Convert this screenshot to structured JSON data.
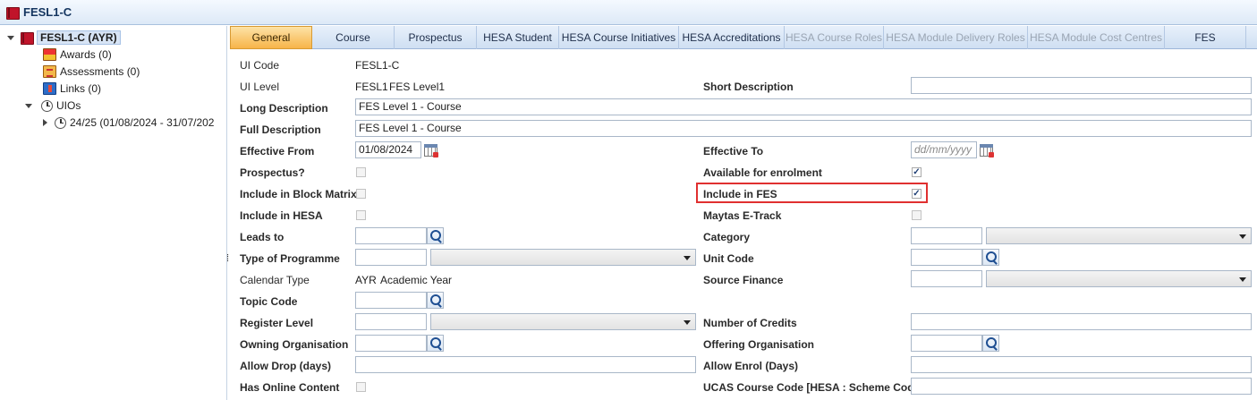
{
  "window": {
    "title": "FESL1-C"
  },
  "tree": {
    "root": "FESL1-C (AYR)",
    "awards": "Awards (0)",
    "assessments": "Assessments (0)",
    "links": "Links (0)",
    "uios": "UIOs",
    "uio_child": "24/25 (01/08/2024 - 31/07/202"
  },
  "tabs": [
    {
      "label": "General"
    },
    {
      "label": "Course"
    },
    {
      "label": "Prospectus"
    },
    {
      "label": "HESA Student"
    },
    {
      "label": "HESA Course Initiatives"
    },
    {
      "label": "HESA Accreditations"
    },
    {
      "label": "HESA Course Roles"
    },
    {
      "label": "HESA Module Delivery Roles"
    },
    {
      "label": "HESA Module Cost Centres"
    },
    {
      "label": "FES"
    }
  ],
  "form": {
    "ui_code": {
      "label": "UI Code",
      "value": "FESL1-C"
    },
    "ui_level": {
      "label": "UI Level",
      "code": "FESL1",
      "desc": "FES Level1"
    },
    "short_description": {
      "label": "Short Description",
      "value": ""
    },
    "long_description": {
      "label": "Long Description",
      "value": "FES Level 1 - Course"
    },
    "full_description": {
      "label": "Full Description",
      "value": "FES Level 1 - Course"
    },
    "effective_from": {
      "label": "Effective From",
      "value": "01/08/2024"
    },
    "effective_to": {
      "label": "Effective To",
      "placeholder": "dd/mm/yyyy"
    },
    "prospectus": {
      "label": "Prospectus?",
      "checked": false
    },
    "available_for_enrolment": {
      "label": "Available for enrolment",
      "checked": true
    },
    "include_block_matrix": {
      "label": "Include in Block Matrix",
      "checked": false
    },
    "include_fes": {
      "label": "Include in FES",
      "checked": true
    },
    "include_hesa": {
      "label": "Include in HESA",
      "checked": false
    },
    "maytas_etrack": {
      "label": "Maytas E-Track",
      "checked": false
    },
    "leads_to": {
      "label": "Leads to",
      "value": ""
    },
    "category": {
      "label": "Category",
      "value": ""
    },
    "type_of_programme": {
      "label": "Type of Programme",
      "value": ""
    },
    "unit_code": {
      "label": "Unit Code",
      "value": ""
    },
    "calendar_type": {
      "label": "Calendar Type",
      "code": "AYR",
      "desc": "Academic Year"
    },
    "source_finance": {
      "label": "Source Finance",
      "value": ""
    },
    "topic_code": {
      "label": "Topic Code",
      "value": ""
    },
    "register_level": {
      "label": "Register Level",
      "value": ""
    },
    "number_of_credits": {
      "label": "Number of Credits",
      "value": ""
    },
    "owning_organisation": {
      "label": "Owning Organisation",
      "value": ""
    },
    "offering_organisation": {
      "label": "Offering Organisation",
      "value": ""
    },
    "allow_drop": {
      "label": "Allow Drop (days)",
      "value": ""
    },
    "allow_enrol": {
      "label": "Allow Enrol (Days)",
      "value": ""
    },
    "has_online_content": {
      "label": "Has Online Content",
      "checked": false
    },
    "ucas_course_code": {
      "label": "UCAS Course Code [HESA : Scheme Code]",
      "value": ""
    }
  },
  "icons": {
    "window": "book-icon",
    "awards": "awards-icon",
    "assessments": "assessments-icon",
    "links": "links-icon",
    "uios": "clock-icon",
    "search": "search-icon",
    "calendar": "calendar-icon"
  },
  "colors": {
    "active_tab": "#f7b449",
    "highlight": "#e03030",
    "title": "#14355f"
  }
}
